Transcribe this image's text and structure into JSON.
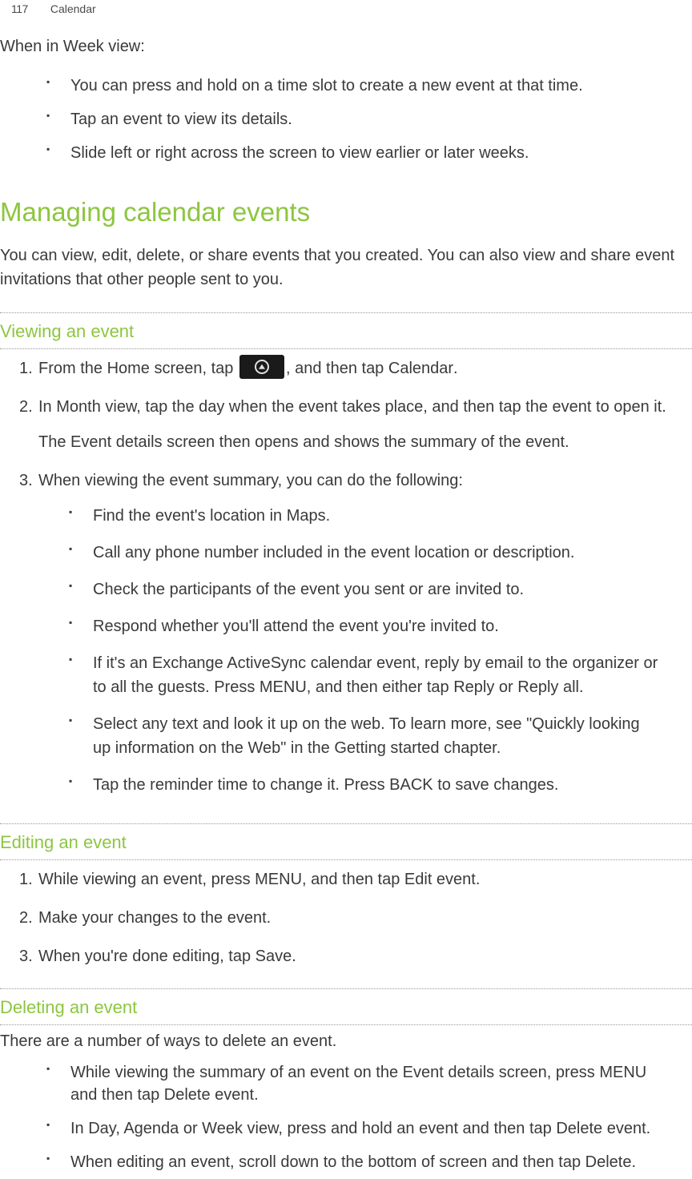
{
  "header": {
    "pageNumber": "117",
    "chapter": "Calendar"
  },
  "intro": "When in Week view:",
  "introBullets": [
    "You can press and hold on a time slot to create a new event at that time.",
    "Tap an event to view its details.",
    "Slide left or right across the screen to view earlier or later weeks."
  ],
  "mainHeading": "Managing calendar events",
  "mainDesc": "You can view, edit, delete, or share events that you created. You can also view and share event invitations that other people sent to you.",
  "sections": {
    "viewing": {
      "title": "Viewing an event",
      "steps": [
        {
          "parts": [
            {
              "text": "From the Home screen, tap "
            },
            {
              "icon": "home-icon"
            },
            {
              "text": ", and then tap "
            },
            {
              "strong": "Calendar"
            },
            {
              "text": "."
            }
          ]
        },
        {
          "text": "In Month view, tap the day when the event takes place, and then tap the event to open it.",
          "note": "The Event details screen then opens and shows the summary of the event."
        },
        {
          "text": "When viewing the event summary, you can do the following:",
          "bullets": [
            [
              {
                "text": "Find the event's location in "
              },
              {
                "strong": "Maps"
              },
              {
                "text": "."
              }
            ],
            [
              {
                "text": "Call any phone number included in the event location or description."
              }
            ],
            [
              {
                "text": "Check the participants of the event you sent or are invited to."
              }
            ],
            [
              {
                "text": "Respond whether you'll attend the event you're invited to."
              }
            ],
            [
              {
                "text": "If it's an Exchange ActiveSync calendar event, reply by email to the organizer or to all the guests. Press MENU, and then either tap "
              },
              {
                "strong": "Reply"
              },
              {
                "text": " or "
              },
              {
                "strong": "Reply all"
              },
              {
                "text": "."
              }
            ],
            [
              {
                "text": "Select any text and look it up on the web. To learn more, see \"Quickly looking up information on the Web\" in the Getting started chapter."
              }
            ],
            [
              {
                "text": "Tap the reminder time to change it. Press BACK to save changes."
              }
            ]
          ]
        }
      ]
    },
    "editing": {
      "title": "Editing an event",
      "steps": [
        {
          "parts": [
            {
              "text": "While viewing an event, press MENU, and then tap "
            },
            {
              "strong": "Edit event"
            },
            {
              "text": "."
            }
          ]
        },
        {
          "text": "Make your changes to the event."
        },
        {
          "parts": [
            {
              "text": "When you're done editing, tap "
            },
            {
              "strong": "Save"
            },
            {
              "text": "."
            }
          ]
        }
      ]
    },
    "deleting": {
      "title": "Deleting an event",
      "intro": "There are a number of ways to delete an event.",
      "bullets": [
        [
          {
            "text": "While viewing the summary of an event on the Event details screen, press MENU and then tap "
          },
          {
            "strong": "Delete event"
          },
          {
            "text": "."
          }
        ],
        [
          {
            "text": "In Day, Agenda or Week view, press and hold an event and then tap "
          },
          {
            "strong": "Delete event"
          },
          {
            "text": "."
          }
        ],
        [
          {
            "text": "When editing an event, scroll down to the bottom of screen and then tap "
          },
          {
            "strong": "Delete"
          },
          {
            "text": "."
          }
        ]
      ]
    }
  }
}
